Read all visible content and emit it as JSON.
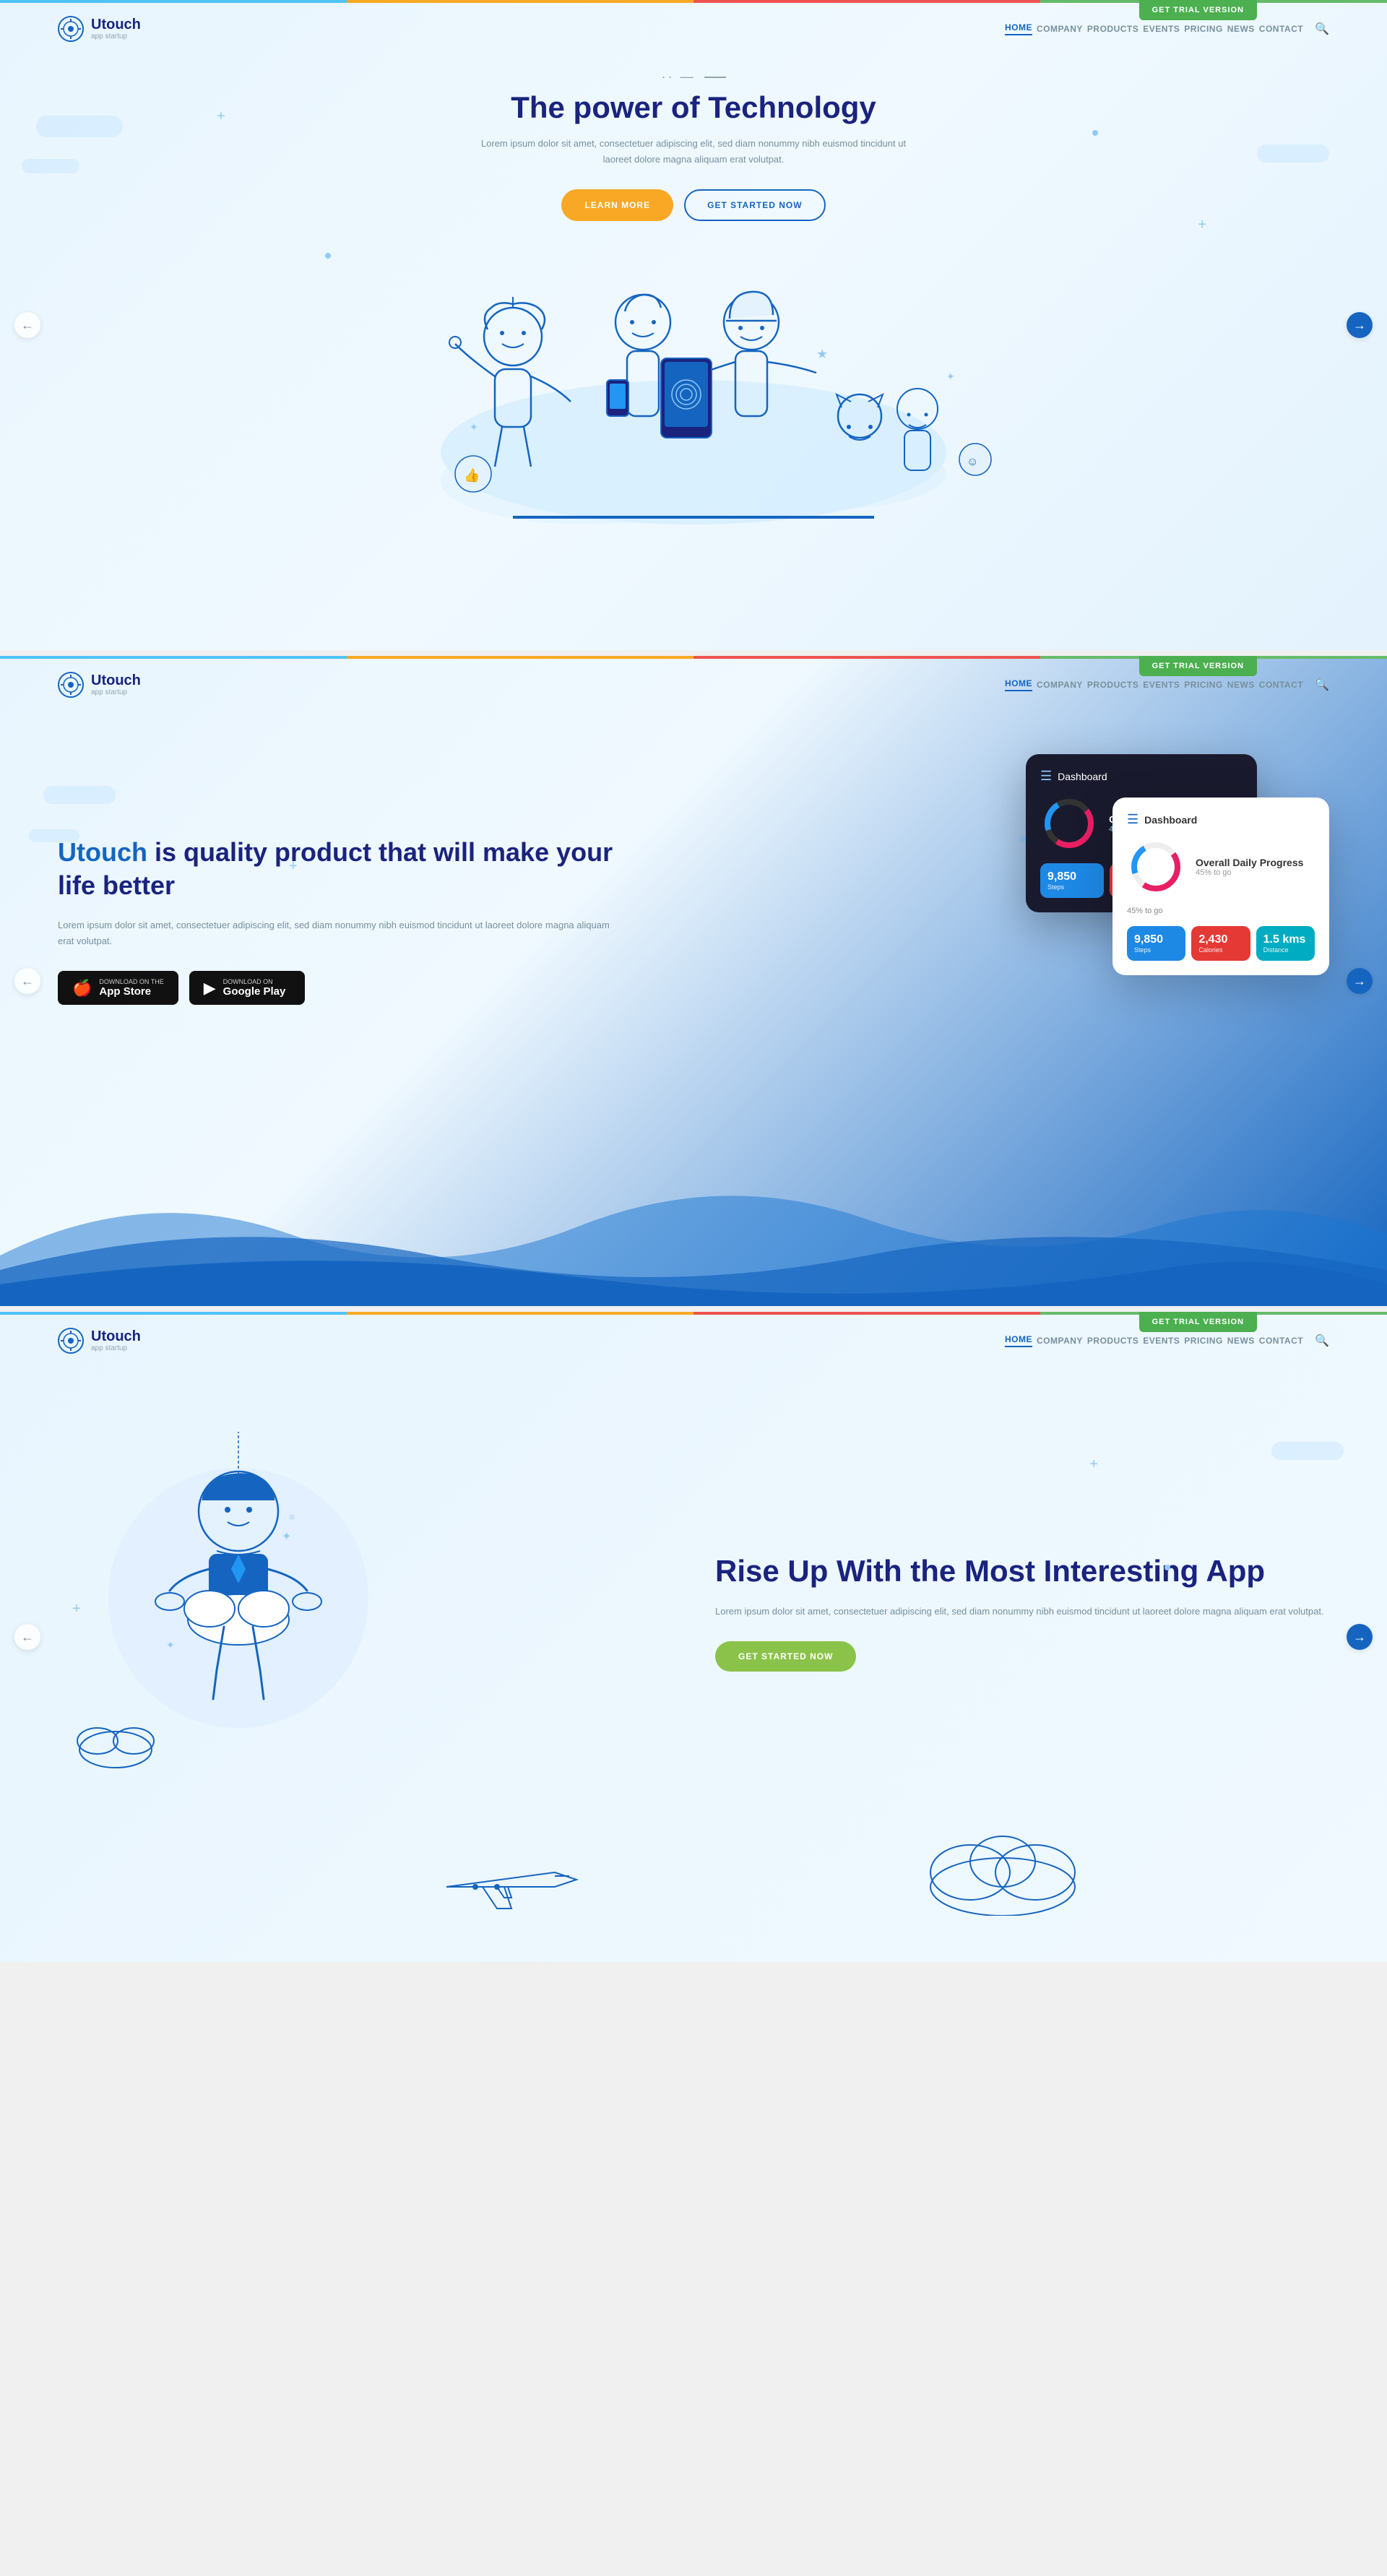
{
  "brand": {
    "name": "Utouch",
    "tagline": "app startup",
    "logo_symbol": "👆"
  },
  "nav": {
    "links": [
      "HOME",
      "COMPANY",
      "PRODUCTS",
      "EVENTS",
      "PRICING",
      "NEWS",
      "CONTACT"
    ],
    "active": "HOME",
    "search_placeholder": "Search..."
  },
  "trial_button": "GET TRIAL VERSION",
  "slide1": {
    "headline_deco_left": "·—",
    "headline_deco_right": "—·",
    "title": "The power of Technology",
    "description": "Lorem ipsum dolor sit amet, consectetuer adipiscing elit, sed diam nonummy nibh euismod tincidunt ut laoreet dolore magna aliquam erat volutpat.",
    "btn_learn": "LEARN MORE",
    "btn_started": "GET STARTED NOW",
    "arrow_left": "←",
    "arrow_right": "→"
  },
  "slide2": {
    "title_prefix": "Utouch",
    "title_rest": " is quality product that will make your life better",
    "description": "Lorem ipsum dolor sit amet, consectetuer adipiscing elit, sed diam nonummy nibh euismod tincidunt ut laoreet dolore magna aliquam erat volutpat.",
    "app_store_label": "Download on the",
    "app_store_name": "App Store",
    "google_play_label": "Download on",
    "google_play_name": "Google Play",
    "arrow_left": "←",
    "arrow_right": "→",
    "dashboard": {
      "title": "Dashboard",
      "progress_title": "Overall Daily Progress",
      "progress_sub": "45% to go",
      "stat_label": "45% to go",
      "tiles": [
        {
          "num": "9,850",
          "label": "Steps",
          "color": "blue"
        },
        {
          "num": "2,430",
          "label": "Calories Burned",
          "color": "red"
        },
        {
          "num": "1.5 kms",
          "label": "Distance",
          "color": "teal"
        }
      ]
    }
  },
  "slide3": {
    "title": "Rise Up With the Most Interesting App",
    "description": "Lorem ipsum dolor sit amet, consectetuer adipiscing elit, sed diam nonummy nibh euismod tincidunt ut laoreet dolore magna aliquam erat volutpat.",
    "btn_started": "GET STARTED NOW",
    "arrow_left": "←",
    "arrow_right": "→"
  },
  "colors": {
    "accent_blue": "#1565c0",
    "accent_yellow": "#f9a825",
    "accent_green": "#8bc34a",
    "accent_red": "#ef5350",
    "light_blue": "#e3f2fd",
    "dark_navy": "#1a237e"
  }
}
